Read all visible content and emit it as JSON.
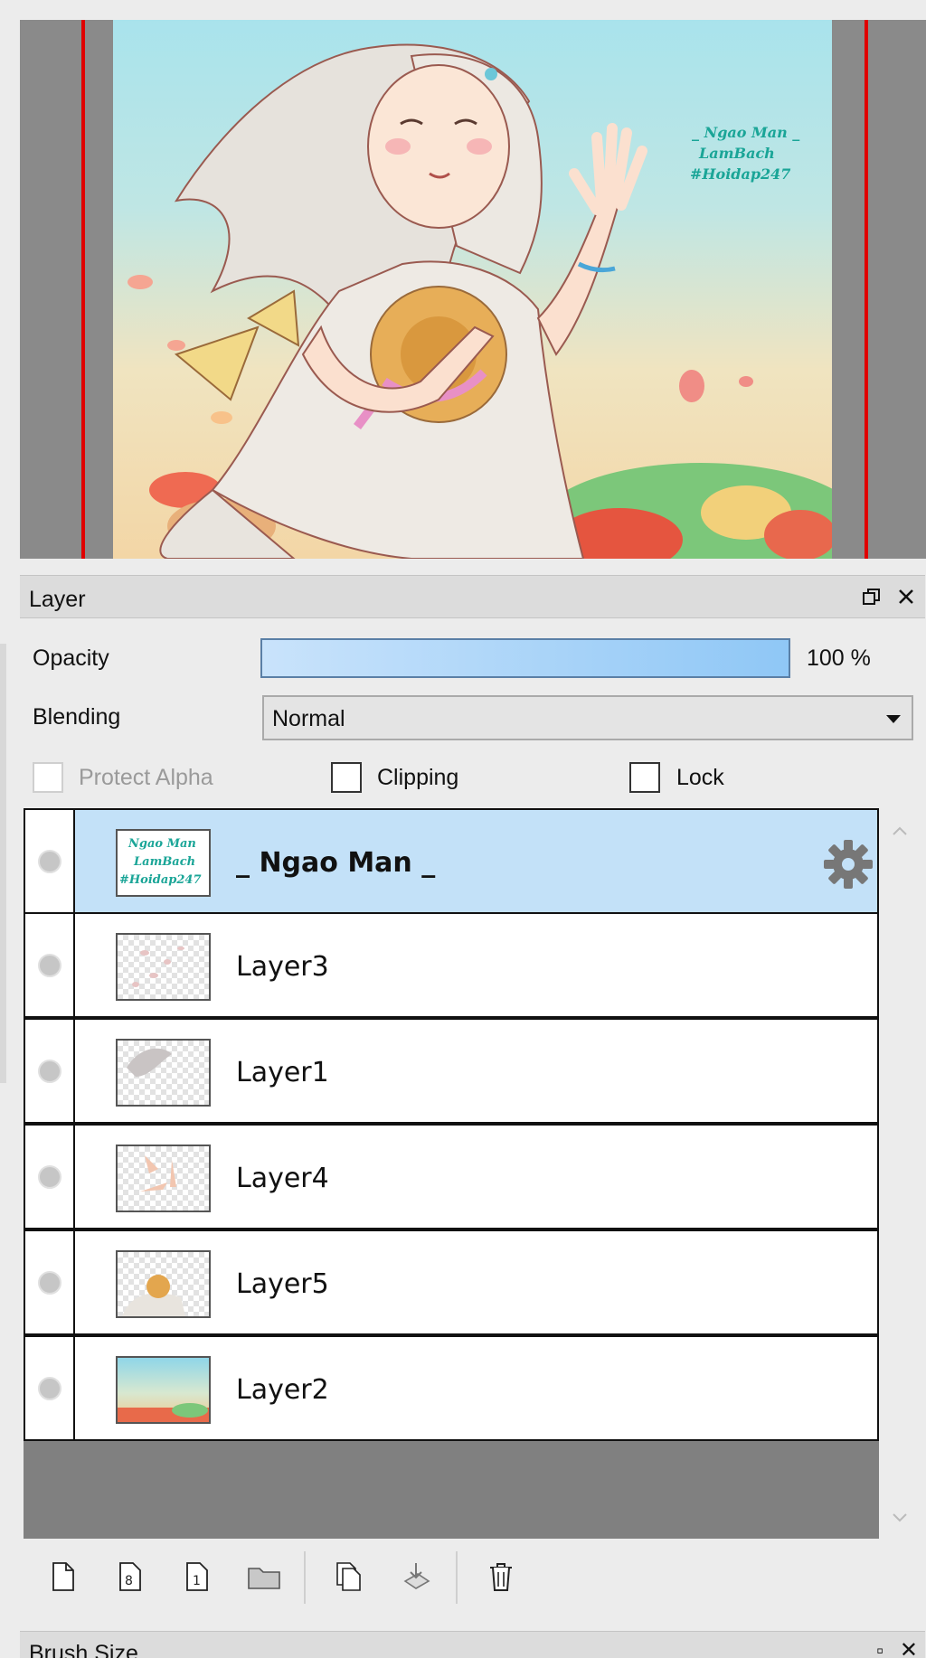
{
  "layer_panel": {
    "title": "Layer",
    "opacity_label": "Opacity",
    "opacity_value_text": "100 %",
    "opacity_fraction": 1.0,
    "blending_label": "Blending",
    "blending_value": "Normal",
    "protect_alpha_label": "Protect Alpha",
    "clipping_label": "Clipping",
    "lock_label": "Lock",
    "layers": [
      {
        "name": "_ Ngao Man _",
        "selected": true
      },
      {
        "name": "Layer3",
        "selected": false
      },
      {
        "name": "Layer1",
        "selected": false
      },
      {
        "name": "Layer4",
        "selected": false
      },
      {
        "name": "Layer5",
        "selected": false
      },
      {
        "name": "Layer2",
        "selected": false
      }
    ]
  },
  "artwork": {
    "signature_lines": [
      "_ Ngao Man _",
      "LamBach",
      "#Hoidap247"
    ]
  },
  "toolbar": {
    "buttons": [
      "new-layer-icon",
      "new-8bit-layer-icon",
      "new-1bit-layer-icon",
      "new-folder-icon",
      "duplicate-layer-icon",
      "merge-down-icon",
      "delete-layer-icon"
    ]
  },
  "bottom_panel": {
    "title": "Brush Size"
  },
  "colors": {
    "selection": "#c3e1f8",
    "opacity_bar_start": "#c9e3fb",
    "opacity_bar_end": "#8fc7f6",
    "canvas_guide": "#e00000"
  }
}
